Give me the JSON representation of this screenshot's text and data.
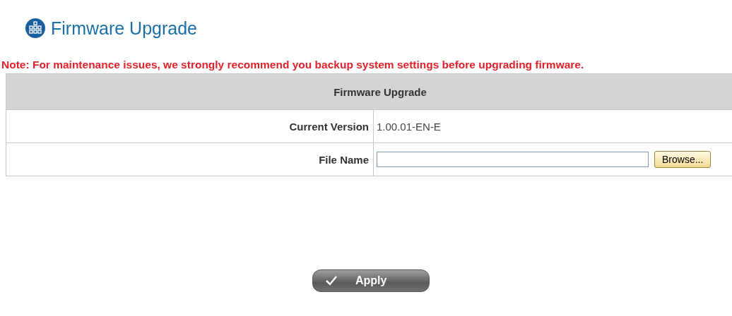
{
  "page_title": "Firmware Upgrade",
  "note": "Note: For maintenance issues, we strongly recommend you backup system settings before upgrading firmware.",
  "table": {
    "header": "Firmware Upgrade",
    "rows": [
      {
        "kind": "text",
        "label": "Current Version",
        "value": "1.00.01-EN-E"
      },
      {
        "kind": "file",
        "label": "File Name",
        "button": "Browse..."
      }
    ]
  },
  "apply_button": "Apply"
}
